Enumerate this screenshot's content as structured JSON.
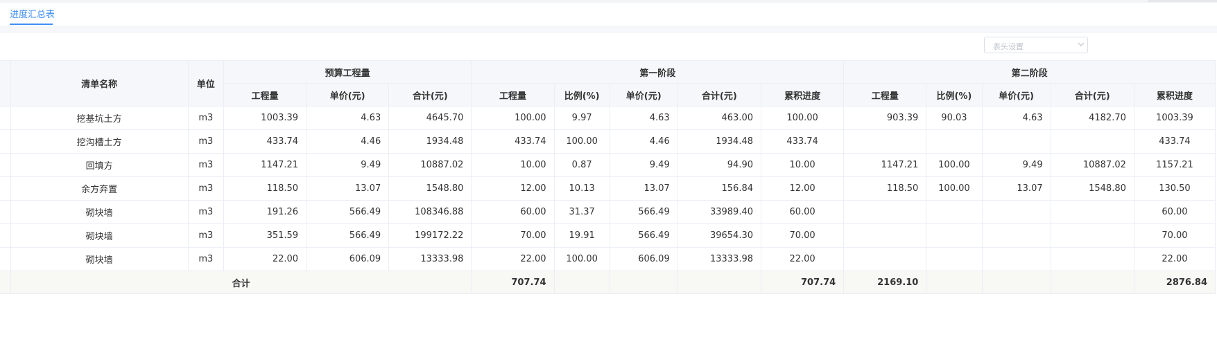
{
  "tabs": [
    {
      "label": "进度汇总表",
      "active": true
    }
  ],
  "toolbar": {
    "header_setting_label": "表头设置",
    "header_setting_icon": "chevron-down-icon"
  },
  "colors": {
    "accent": "#3e8ef7",
    "over_progress": "#e03e2d"
  },
  "table": {
    "headers": {
      "name": "清单名称",
      "unit": "单位",
      "budget_group": "预算工程量",
      "stage1_group": "第一阶段",
      "stage2_group": "第二阶段",
      "budget_cols": [
        "工程量",
        "单价(元)",
        "合计(元)"
      ],
      "stage1_cols": [
        "工程量",
        "比例(%)",
        "单价(元)",
        "合计(元)",
        "累积进度"
      ],
      "stage2_cols": [
        "工程量",
        "比例(%)",
        "单价(元)",
        "合计(元)",
        "累积进度"
      ]
    },
    "rows": [
      {
        "name": "挖基坑土方",
        "unit": "m3",
        "b_qty": "1003.39",
        "b_price": "4.63",
        "b_total": "4645.70",
        "s1_qty": "100.00",
        "s1_ratio": "9.97",
        "s1_price": "4.63",
        "s1_total": "463.00",
        "s1_cum": "100.00",
        "s2_qty": "903.39",
        "s2_ratio": "90.03",
        "s2_price": "4.63",
        "s2_total": "4182.70",
        "s2_cum": "1003.39",
        "s2_cum_over": false
      },
      {
        "name": "挖沟槽土方",
        "unit": "m3",
        "b_qty": "433.74",
        "b_price": "4.46",
        "b_total": "1934.48",
        "s1_qty": "433.74",
        "s1_ratio": "100.00",
        "s1_price": "4.46",
        "s1_total": "1934.48",
        "s1_cum": "433.74",
        "s2_qty": "",
        "s2_ratio": "",
        "s2_price": "",
        "s2_total": "",
        "s2_cum": "433.74",
        "s2_cum_over": false
      },
      {
        "name": "回填方",
        "unit": "m3",
        "b_qty": "1147.21",
        "b_price": "9.49",
        "b_total": "10887.02",
        "s1_qty": "10.00",
        "s1_ratio": "0.87",
        "s1_price": "9.49",
        "s1_total": "94.90",
        "s1_cum": "10.00",
        "s2_qty": "1147.21",
        "s2_ratio": "100.00",
        "s2_price": "9.49",
        "s2_total": "10887.02",
        "s2_cum": "1157.21",
        "s2_cum_over": true
      },
      {
        "name": "余方弃置",
        "unit": "m3",
        "b_qty": "118.50",
        "b_price": "13.07",
        "b_total": "1548.80",
        "s1_qty": "12.00",
        "s1_ratio": "10.13",
        "s1_price": "13.07",
        "s1_total": "156.84",
        "s1_cum": "12.00",
        "s2_qty": "118.50",
        "s2_ratio": "100.00",
        "s2_price": "13.07",
        "s2_total": "1548.80",
        "s2_cum": "130.50",
        "s2_cum_over": true
      },
      {
        "name": "砌块墙",
        "unit": "m3",
        "b_qty": "191.26",
        "b_price": "566.49",
        "b_total": "108346.88",
        "s1_qty": "60.00",
        "s1_ratio": "31.37",
        "s1_price": "566.49",
        "s1_total": "33989.40",
        "s1_cum": "60.00",
        "s2_qty": "",
        "s2_ratio": "",
        "s2_price": "",
        "s2_total": "",
        "s2_cum": "60.00",
        "s2_cum_over": false
      },
      {
        "name": "砌块墙",
        "unit": "m3",
        "b_qty": "351.59",
        "b_price": "566.49",
        "b_total": "199172.22",
        "s1_qty": "70.00",
        "s1_ratio": "19.91",
        "s1_price": "566.49",
        "s1_total": "39654.30",
        "s1_cum": "70.00",
        "s2_qty": "",
        "s2_ratio": "",
        "s2_price": "",
        "s2_total": "",
        "s2_cum": "70.00",
        "s2_cum_over": false
      },
      {
        "name": "砌块墙",
        "unit": "m3",
        "b_qty": "22.00",
        "b_price": "606.09",
        "b_total": "13333.98",
        "s1_qty": "22.00",
        "s1_ratio": "100.00",
        "s1_price": "606.09",
        "s1_total": "13333.98",
        "s1_cum": "22.00",
        "s2_qty": "",
        "s2_ratio": "",
        "s2_price": "",
        "s2_total": "",
        "s2_cum": "22.00",
        "s2_cum_over": false
      }
    ],
    "total": {
      "label": "合计",
      "s1_qty": "707.74",
      "s1_cum": "707.74",
      "s2_qty": "2169.10",
      "s2_cum": "2876.84"
    }
  }
}
